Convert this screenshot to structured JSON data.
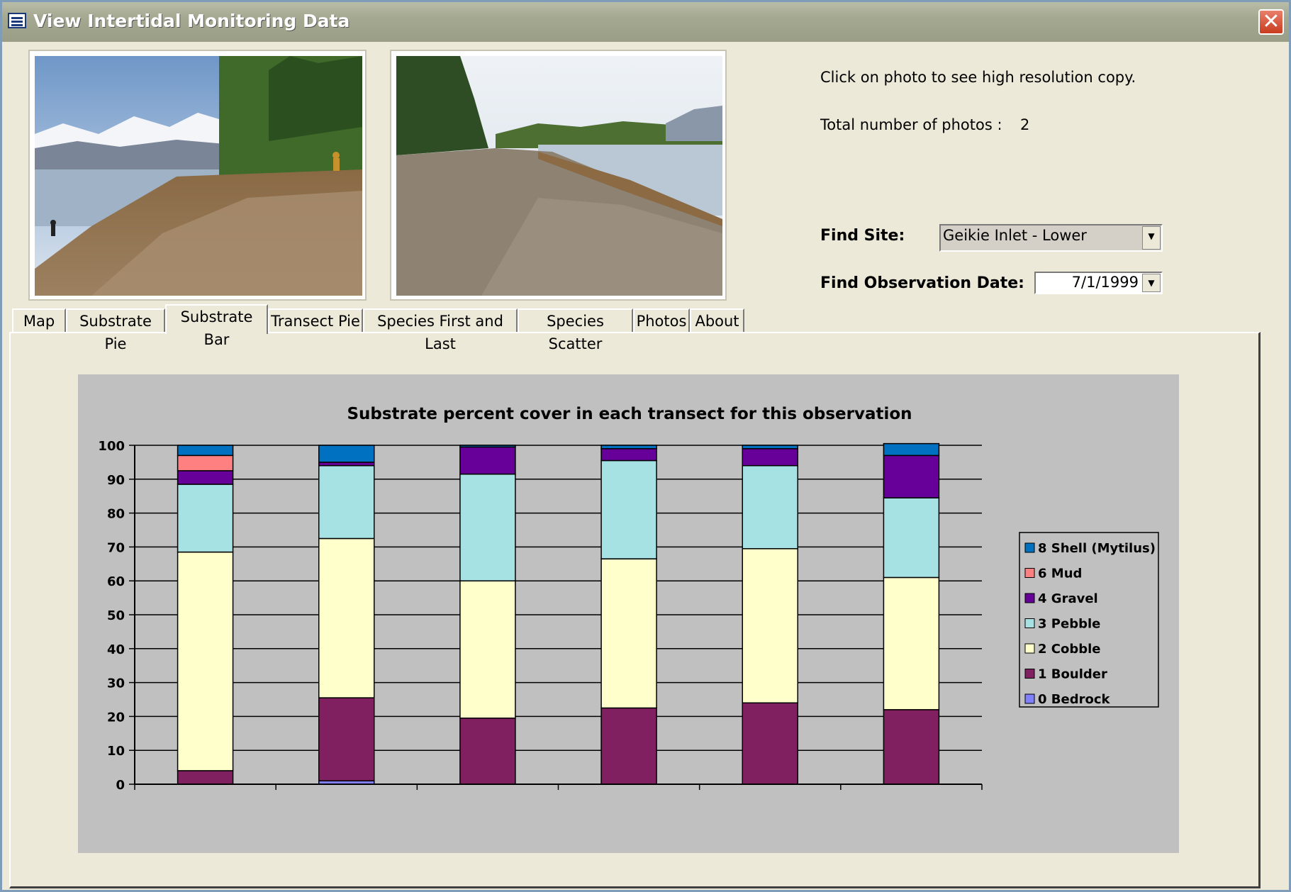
{
  "window": {
    "title": "View Intertidal Monitoring  Data",
    "close_label": "✕"
  },
  "info": {
    "click_text": "Click on photo to see high resolution copy.",
    "total_label": "Total number of photos :",
    "total_value": "2"
  },
  "find_site": {
    "label": "Find Site:",
    "value": "Geikie Inlet - Lower"
  },
  "find_date": {
    "label": "Find Observation Date:",
    "value": "7/1/1999"
  },
  "tabs": [
    {
      "label": "Map"
    },
    {
      "label": "Substrate Pie"
    },
    {
      "label": "Substrate Bar"
    },
    {
      "label": "Transect Pie"
    },
    {
      "label": "Species First and Last"
    },
    {
      "label": "Species Scatter"
    },
    {
      "label": "Photos"
    },
    {
      "label": "About"
    }
  ],
  "active_tab": 2,
  "chart_data": {
    "type": "bar",
    "stacked": true,
    "title": "Substrate percent cover in each transect for this observation",
    "xlabel": "",
    "ylabel": "",
    "ylim": [
      0,
      100
    ],
    "yticks": [
      0,
      10,
      20,
      30,
      40,
      50,
      60,
      70,
      80,
      90,
      100
    ],
    "categories": [
      "",
      "",
      "",
      "",
      "",
      ""
    ],
    "grid": true,
    "legend_position": "right",
    "series": [
      {
        "name": "0 Bedrock",
        "color": "#8080ff",
        "values": [
          0,
          1,
          0,
          0,
          0,
          0
        ]
      },
      {
        "name": "1 Boulder",
        "color": "#802060",
        "values": [
          4,
          24.5,
          19.5,
          22.5,
          24,
          22
        ]
      },
      {
        "name": "2 Cobble",
        "color": "#ffffcc",
        "values": [
          64.5,
          47,
          40.5,
          44,
          45.5,
          39
        ]
      },
      {
        "name": "3 Pebble",
        "color": "#a6e1e3",
        "values": [
          20,
          21.5,
          31.5,
          29,
          24.5,
          23.5
        ]
      },
      {
        "name": "4 Gravel",
        "color": "#660099",
        "values": [
          4,
          1,
          8,
          3.5,
          5,
          12.5
        ]
      },
      {
        "name": "6 Mud",
        "color": "#ff8080",
        "values": [
          4.5,
          0,
          0,
          0,
          0,
          0
        ]
      },
      {
        "name": "8 Shell (Mytilus)",
        "color": "#0070c0",
        "values": [
          3,
          5,
          0.5,
          1,
          1,
          3.5
        ]
      }
    ]
  }
}
